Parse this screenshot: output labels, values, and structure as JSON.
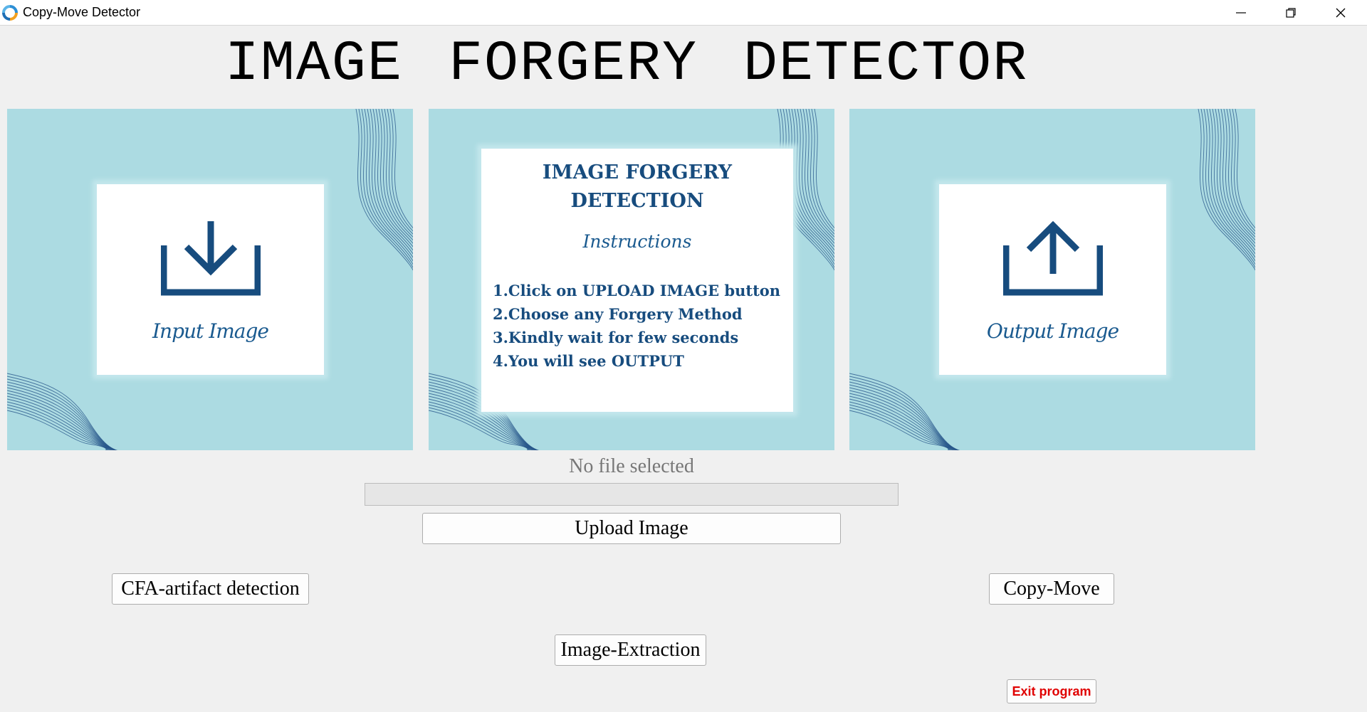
{
  "window": {
    "title": "Copy-Move Detector",
    "icon": "app-logo-icon",
    "controls": [
      "minimize-icon",
      "restore-icon",
      "close-icon"
    ]
  },
  "heading": "IMAGE FORGERY DETECTOR",
  "colors": {
    "panel_bg": "#acdbe2",
    "accent_blue": "#1a5a8f",
    "exit_text": "#e00000",
    "wave_lines": "#1f4e84"
  },
  "panels": {
    "input": {
      "caption": "Input Image",
      "icon": "download-icon"
    },
    "instructions": {
      "title": "IMAGE FORGERY DETECTION",
      "subtitle": "Instructions",
      "steps": [
        "1.Click on UPLOAD IMAGE button",
        "2.Choose any Forgery Method",
        "3.Kindly wait for few seconds",
        "4.You will see OUTPUT"
      ]
    },
    "output": {
      "caption": "Output Image",
      "icon": "upload-icon"
    }
  },
  "status": {
    "file_label": "No file selected",
    "progress": 0
  },
  "buttons": {
    "upload": "Upload Image",
    "cfa": "CFA-artifact detection",
    "copy_move": "Copy-Move",
    "extraction": "Image-Extraction",
    "exit": "Exit program"
  }
}
